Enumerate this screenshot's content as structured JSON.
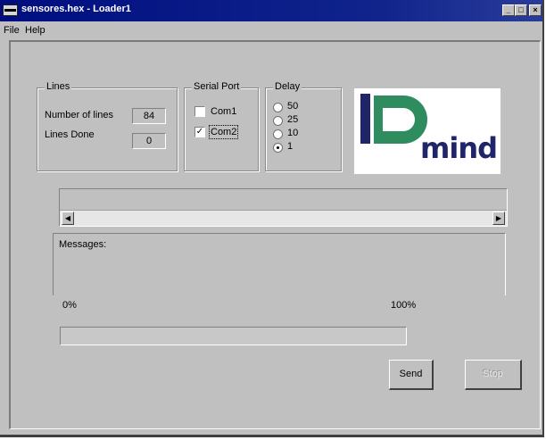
{
  "window": {
    "title": "sensores.hex - Loader1",
    "controls": [
      "_",
      "□",
      "×"
    ]
  },
  "menu": {
    "items": [
      "File",
      "Help"
    ]
  },
  "lines": {
    "title": "Lines",
    "number_of_lines_label": "Number of lines",
    "number_of_lines_value": "84",
    "lines_done_label": "Lines Done",
    "lines_done_value": "0"
  },
  "serial_port": {
    "title": "Serial Port",
    "options": [
      {
        "label": "Com1",
        "checked": false
      },
      {
        "label": "Com2",
        "checked": true
      }
    ]
  },
  "delay": {
    "title": "Delay",
    "options": [
      {
        "label": "50",
        "selected": false
      },
      {
        "label": "25",
        "selected": false
      },
      {
        "label": "10",
        "selected": false
      },
      {
        "label": "1",
        "selected": true
      }
    ]
  },
  "logo": {
    "text": "mind"
  },
  "messages": {
    "label": "Messages:"
  },
  "progress": {
    "min_label": "0%",
    "max_label": "100%",
    "value": 0
  },
  "buttons": {
    "send": "Send",
    "stop": "Stop"
  }
}
